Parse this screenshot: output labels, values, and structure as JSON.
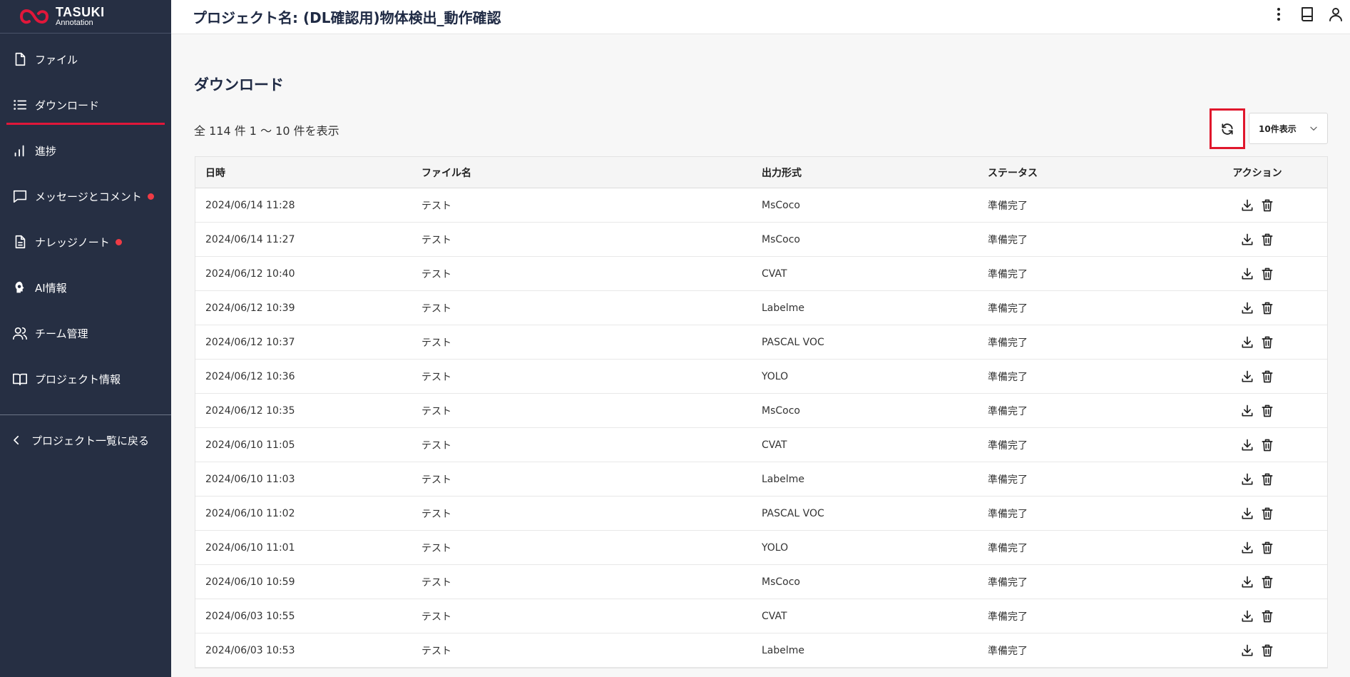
{
  "app": {
    "logo_line1": "TASUKI",
    "logo_line2": "Annotation",
    "brand_color": "#e0173a",
    "sidebar_bg": "#262f43"
  },
  "sidebar": {
    "items": [
      {
        "label": "ファイル",
        "icon": "file-icon"
      },
      {
        "label": "ダウンロード",
        "icon": "list-icon",
        "active": true
      },
      {
        "label": "進捗",
        "icon": "bar-chart-icon"
      },
      {
        "label": "メッセージとコメント",
        "icon": "message-icon",
        "badge": true
      },
      {
        "label": "ナレッジノート",
        "icon": "document-icon",
        "badge": true
      },
      {
        "label": "AI情報",
        "icon": "ai-head-icon"
      },
      {
        "label": "チーム管理",
        "icon": "team-icon"
      },
      {
        "label": "プロジェクト情報",
        "icon": "book-open-icon"
      }
    ],
    "back_label": "プロジェクト一覧に戻る"
  },
  "header": {
    "title": "プロジェクト名: (DL確認用)物体検出_動作確認",
    "icons": [
      "more-vertical-icon",
      "manual-book-icon",
      "user-icon"
    ]
  },
  "main": {
    "section_title": "ダウンロード",
    "count_text": "全 114 件 1 〜 10 件を表示",
    "per_page_selected": "10件表示",
    "refresh_icon": "refresh-icon"
  },
  "table": {
    "headers": [
      "日時",
      "ファイル名",
      "出力形式",
      "ステータス",
      "アクション"
    ],
    "rows": [
      {
        "date": "2024/06/14 11:28",
        "filename": "テスト",
        "format": "MsCoco",
        "status": "準備完了"
      },
      {
        "date": "2024/06/14 11:27",
        "filename": "テスト",
        "format": "MsCoco",
        "status": "準備完了"
      },
      {
        "date": "2024/06/12 10:40",
        "filename": "テスト",
        "format": "CVAT",
        "status": "準備完了"
      },
      {
        "date": "2024/06/12 10:39",
        "filename": "テスト",
        "format": "Labelme",
        "status": "準備完了"
      },
      {
        "date": "2024/06/12 10:37",
        "filename": "テスト",
        "format": "PASCAL VOC",
        "status": "準備完了"
      },
      {
        "date": "2024/06/12 10:36",
        "filename": "テスト",
        "format": "YOLO",
        "status": "準備完了"
      },
      {
        "date": "2024/06/12 10:35",
        "filename": "テスト",
        "format": "MsCoco",
        "status": "準備完了"
      },
      {
        "date": "2024/06/10 11:05",
        "filename": "テスト",
        "format": "CVAT",
        "status": "準備完了"
      },
      {
        "date": "2024/06/10 11:03",
        "filename": "テスト",
        "format": "Labelme",
        "status": "準備完了"
      },
      {
        "date": "2024/06/10 11:02",
        "filename": "テスト",
        "format": "PASCAL VOC",
        "status": "準備完了"
      },
      {
        "date": "2024/06/10 11:01",
        "filename": "テスト",
        "format": "YOLO",
        "status": "準備完了"
      },
      {
        "date": "2024/06/10 10:59",
        "filename": "テスト",
        "format": "MsCoco",
        "status": "準備完了"
      },
      {
        "date": "2024/06/03 10:55",
        "filename": "テスト",
        "format": "CVAT",
        "status": "準備完了"
      },
      {
        "date": "2024/06/03 10:53",
        "filename": "テスト",
        "format": "Labelme",
        "status": "準備完了"
      }
    ]
  }
}
